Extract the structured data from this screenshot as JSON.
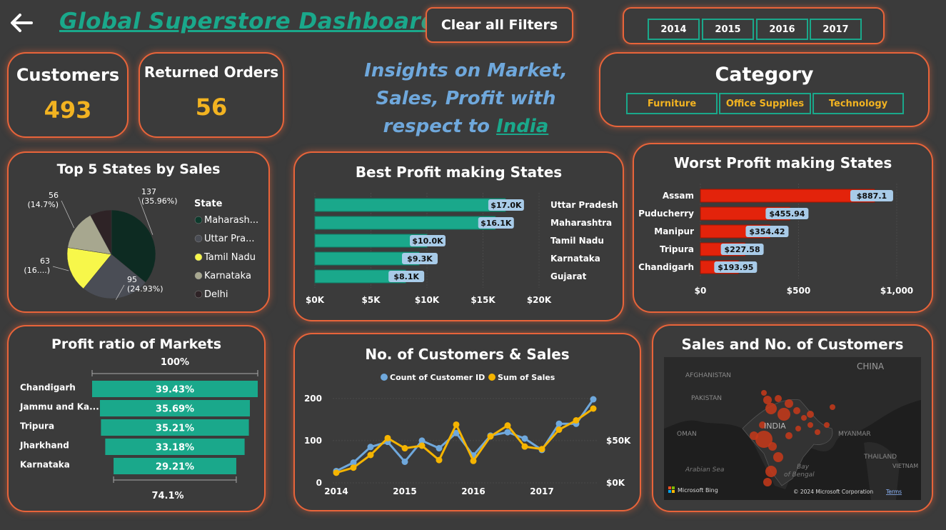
{
  "header": {
    "title": "Global Superstore Dashboard",
    "clear_filters": "Clear all Filters",
    "years": [
      "2014",
      "2015",
      "2016",
      "2017"
    ]
  },
  "kpis": {
    "customers_label": "Customers",
    "customers_value": "493",
    "returned_label": "Returned Orders",
    "returned_value": "56"
  },
  "insight": {
    "line1": "Insights on Market,",
    "line2": "Sales, Profit with",
    "line3_prefix": "respect to ",
    "country": "India"
  },
  "category": {
    "title": "Category",
    "items": [
      "Furniture",
      "Office Supplies",
      "Technology"
    ]
  },
  "colors": {
    "accent_border": "#e8643a",
    "teal": "#1aa88b",
    "gold": "#f2b321",
    "red_bar": "#e3230b",
    "label_bg": "#a8cbe8",
    "blue_line": "#6fa8dc",
    "orange_line": "#f5b400"
  },
  "chart_data": [
    {
      "id": "top5_states",
      "type": "pie",
      "title": "Top 5 States by Sales",
      "legend_title": "State",
      "slices": [
        {
          "name": "Maharash...",
          "value": 137,
          "label": "137\n(35.96%)",
          "color": "#0d2b22"
        },
        {
          "name": "Uttar Pra...",
          "value": 95,
          "label": "95\n(24.93%)",
          "color": "#4a4d55"
        },
        {
          "name": "Tamil Nadu",
          "value": 63,
          "label": "63\n(16....)",
          "color": "#f7f74a"
        },
        {
          "name": "Karnataka",
          "value": 56,
          "label": "56\n(14.7%)",
          "color": "#a7a78f"
        },
        {
          "name": "Delhi",
          "value": 30,
          "label": "",
          "color": "#2e2326"
        }
      ]
    },
    {
      "id": "best_profit",
      "type": "bar",
      "orientation": "horizontal",
      "title": "Best Profit making States",
      "categories": [
        "Uttar Pradesh",
        "Maharashtra",
        "Tamil Nadu",
        "Karnataka",
        "Gujarat"
      ],
      "values": [
        17000,
        16100,
        10000,
        9300,
        8100
      ],
      "value_labels": [
        "$17.0K",
        "$16.1K",
        "$10.0K",
        "$9.3K",
        "$8.1K"
      ],
      "xlim": [
        0,
        20000
      ],
      "xticks": [
        "$0K",
        "$5K",
        "$10K",
        "$15K",
        "$20K"
      ]
    },
    {
      "id": "worst_profit",
      "type": "bar",
      "orientation": "horizontal",
      "title": "Worst Profit making States",
      "categories": [
        "Assam",
        "Puducherry",
        "Manipur",
        "Tripura",
        "Chandigarh"
      ],
      "values": [
        887.1,
        455.94,
        354.42,
        227.58,
        193.95
      ],
      "value_labels": [
        "$887.1",
        "$455.94",
        "$354.42",
        "$227.58",
        "$193.95"
      ],
      "xlim": [
        0,
        1000
      ],
      "xticks": [
        "$0",
        "$500",
        "$1,000"
      ]
    },
    {
      "id": "profit_ratio",
      "type": "bar",
      "orientation": "horizontal",
      "title": "Profit ratio of Markets",
      "categories": [
        "Chandigarh",
        "Jammu and Ka...",
        "Tripura",
        "Jharkhand",
        "Karnataka"
      ],
      "values": [
        39.43,
        35.69,
        35.21,
        33.18,
        29.21
      ],
      "value_labels": [
        "39.43%",
        "35.69%",
        "35.21%",
        "33.18%",
        "29.21%"
      ],
      "top_label": "100%",
      "bottom_label": "74.1%"
    },
    {
      "id": "customers_sales",
      "type": "line",
      "title": "No. of Customers & Sales",
      "legend": [
        "Count of Customer ID",
        "Sum of Sales"
      ],
      "x": [
        0,
        1,
        2,
        3,
        4,
        5,
        6,
        7,
        8,
        9,
        10,
        11,
        12,
        13,
        14,
        15,
        16
      ],
      "x_tick_labels": [
        "2014",
        "2015",
        "2016",
        "2017"
      ],
      "x_tick_positions": [
        0,
        4,
        8,
        12
      ],
      "series": [
        {
          "name": "Count of Customer ID",
          "axis": "left",
          "color": "#6fa8dc",
          "values": [
            28,
            48,
            85,
            97,
            50,
            100,
            82,
            118,
            65,
            112,
            120,
            105,
            78,
            140,
            140,
            198
          ]
        },
        {
          "name": "Sum of Sales",
          "axis": "right",
          "color": "#f5b400",
          "values": [
            12000,
            18000,
            33000,
            53000,
            41000,
            44000,
            27000,
            69000,
            26000,
            55000,
            68000,
            43000,
            40000,
            63000,
            74000,
            88000
          ]
        }
      ],
      "y_left_ticks": [
        "0",
        "100",
        "200"
      ],
      "y_left_lim": [
        0,
        220
      ],
      "y_right_ticks": [
        "$0K",
        "$50K"
      ],
      "y_right_lim": [
        0,
        110000
      ]
    }
  ],
  "map": {
    "title": "Sales and No. of Customers",
    "labels": {
      "afghanistan": "AFGHANISTAN",
      "china": "CHINA",
      "pakistan": "PAKISTAN",
      "india": "INDIA",
      "oman": "OMAN",
      "myanmar": "MYANMAR",
      "thailand": "THAILAND",
      "vietnam": "VIETNAM",
      "arabian_sea": "Arabian Sea",
      "bay_of_bengal": "Bay\nof Bengal"
    },
    "bing": "Microsoft Bing",
    "copyright": "© 2024 Microsoft Corporation",
    "terms": "Terms"
  }
}
